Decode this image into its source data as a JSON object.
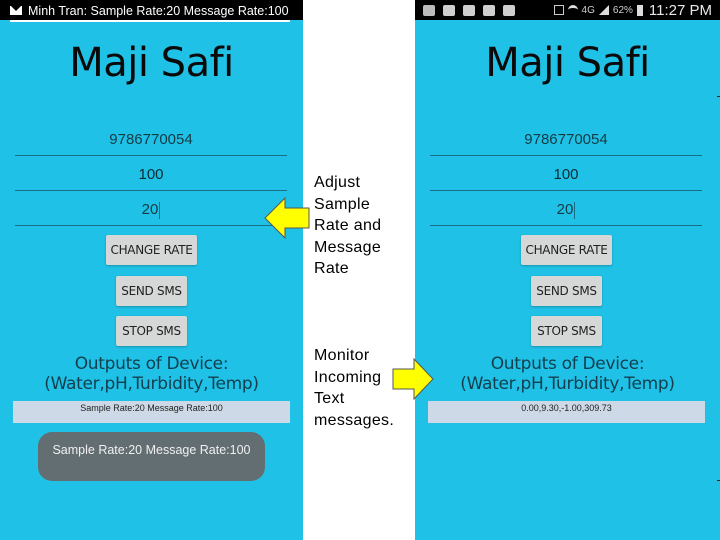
{
  "left_phone": {
    "notification": {
      "icon": "envelope-icon",
      "text": "Minh Tran: Sample Rate:20 Message Rate:100"
    },
    "app_title": "Maji Safi",
    "fields": {
      "phone_number": "9786770054",
      "message_rate": "100",
      "sample_rate": "20"
    },
    "buttons": {
      "change_rate": "CHANGE RATE",
      "send_sms": "SEND SMS",
      "stop_sms": "STOP SMS"
    },
    "outputs_heading_line1": "Outputs of Device:",
    "outputs_heading_line2": "(Water,pH,Turbidity,Temp)",
    "output_value": "Sample Rate:20 Message Rate:100",
    "toast": "Sample Rate:20 Message Rate:100"
  },
  "right_phone": {
    "status_bar": {
      "notification_icons": [
        "chat-icon",
        "envelope-icon",
        "gmail-icon",
        "image-icon",
        "instagram-icon"
      ],
      "system_icons": [
        "mute-icon",
        "wifi-icon",
        "4g-icon",
        "signal-icon"
      ],
      "network": "4G",
      "battery": "62%",
      "time": "11:27 PM"
    },
    "app_title": "Maji Safi",
    "fields": {
      "phone_number": "9786770054",
      "message_rate": "100",
      "sample_rate": "20"
    },
    "buttons": {
      "change_rate": "CHANGE RATE",
      "send_sms": "SEND SMS",
      "stop_sms": "STOP SMS"
    },
    "outputs_heading_line1": "Outputs of Device:",
    "outputs_heading_line2": "(Water,pH,Turbidity,Temp)",
    "output_value": "0.00,9.30,-1.00,309.73"
  },
  "annotations": {
    "adjust": [
      "Adjust",
      "Sample",
      "Rate and",
      "Message",
      "Rate"
    ],
    "monitor": [
      "Monitor",
      "Incoming",
      "Text",
      "messages."
    ],
    "arrow_color": "#ffff00"
  },
  "colors": {
    "app_background": "#1fc2e6",
    "button": "#d6d7d7",
    "output_box": "#cdd9e6",
    "toast": "#636e72"
  }
}
